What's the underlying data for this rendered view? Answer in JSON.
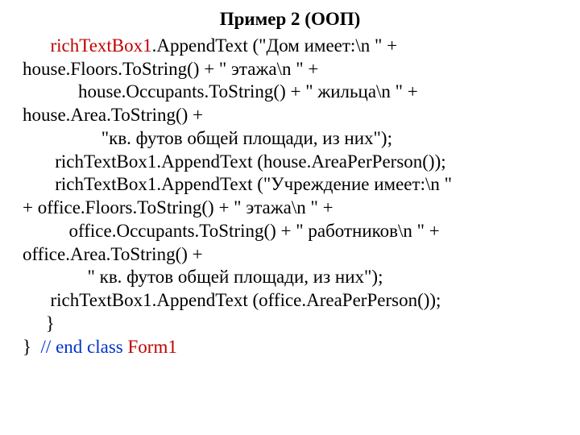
{
  "title": "Пример 2 (ООП)",
  "lines": [
    {
      "segments": [
        {
          "t": "      "
        },
        {
          "t": "richTextBox1",
          "c": "red"
        },
        {
          "t": ".AppendText (\"Дом имеет:\\n \" +"
        }
      ]
    },
    {
      "segments": [
        {
          "t": "house.Floors.ToString() + \" этажа\\n \" +"
        }
      ]
    },
    {
      "segments": [
        {
          "t": "            house.Occupants.ToString() + \" жильца\\n \" + "
        }
      ]
    },
    {
      "segments": [
        {
          "t": "house.Area.ToString() +"
        }
      ]
    },
    {
      "segments": [
        {
          "t": "                 \"кв. футов общей площади, из них\");"
        }
      ]
    },
    {
      "segments": [
        {
          "t": "       richTextBox1.AppendText (house.AreaPerPerson());"
        }
      ]
    },
    {
      "segments": [
        {
          "t": "       richTextBox1.AppendText (\"Учреждение имеет:\\n \" "
        }
      ]
    },
    {
      "segments": [
        {
          "t": "+ office.Floors.ToString() + \" этажа\\n \" +"
        }
      ]
    },
    {
      "segments": [
        {
          "t": "          office.Occupants.ToString() + \" работников\\n \" + "
        }
      ]
    },
    {
      "segments": [
        {
          "t": "office.Area.ToString() +"
        }
      ]
    },
    {
      "segments": [
        {
          "t": "              \" кв. футов общей площади, из них\");"
        }
      ]
    },
    {
      "segments": [
        {
          "t": "      richTextBox1.AppendText (office.AreaPerPerson()); "
        }
      ]
    },
    {
      "segments": [
        {
          "t": "     }"
        }
      ]
    },
    {
      "segments": [
        {
          "t": "}  "
        },
        {
          "t": "// ",
          "c": "blue"
        },
        {
          "t": "end class",
          "c": "blue"
        },
        {
          "t": " "
        },
        {
          "t": "Form1",
          "c": "red"
        }
      ]
    }
  ]
}
